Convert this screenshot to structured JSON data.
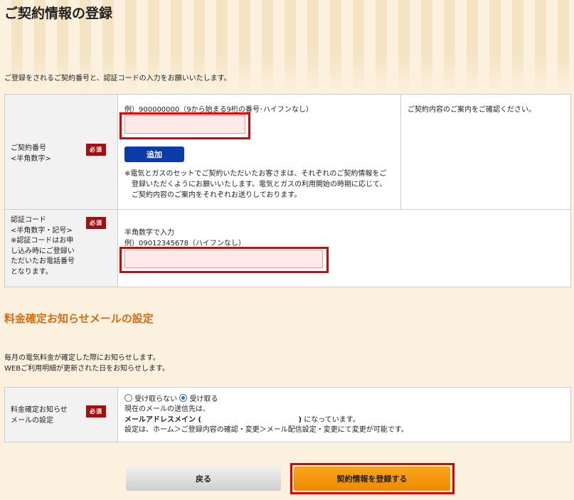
{
  "page": {
    "title": "ご契約情報の登録",
    "intro": "ご登録をされるご契約番号と、認証コードの入力をお願いいたします。"
  },
  "contract": {
    "label_line1": "ご契約番号",
    "label_line2": "<半角数字>",
    "required": "必須",
    "example": "例）900000000（9から始まる9桁の番号･ハイフンなし）",
    "value": "",
    "add_button": "追加",
    "note_line1": "※電気とガスのセットでご契約いただいたお客さまは、それぞれのご契約情報をご",
    "note_line2": "登録いただくようにお願いいたします。電気とガスの利用開始の時期に応じて、",
    "note_line3": "ご契約内容のご案内をそれぞれお送りしております。",
    "side_note": "ご契約内容のご案内をご確認ください。"
  },
  "auth": {
    "label_lines": [
      "認証コード",
      "<半角数字・記号>",
      "※認証コードはお申",
      "し込み時にご登録い",
      "ただいたお電話番号",
      "となります。"
    ],
    "required": "必須",
    "hint": "半角数字で入力",
    "example": "例）09012345678（ハイフンなし）",
    "value": ""
  },
  "mail_section": {
    "title": "料金確定お知らせメールの設定",
    "desc_line1": "毎月の電気料金が確定した際にお知らせします。",
    "desc_line2": "WEBご利用明細が更新された日をお知らせします。"
  },
  "mail": {
    "label_line1": "料金確定お知らせ",
    "label_line2": "メールの設定",
    "required": "必須",
    "option_no": "受け取らない",
    "option_yes": "受け取る",
    "selected": "受け取る",
    "current_prefix": "現在のメールの送信先は、",
    "address_label": "メールアドレスメイン (",
    "address_close": ")",
    "address_suffix": " になっています。",
    "settings_note": "設定は、ホーム＞ご登録内容の確認・変更＞メール配信設定・変更にて変更が可能です。"
  },
  "buttons": {
    "back": "戻る",
    "submit": "契約情報を登録する"
  },
  "colors": {
    "required_badge": "#a40f12",
    "add_button": "#0a3ca8",
    "highlight": "#e00000",
    "section_title": "#d96b0f",
    "submit_button": "#ef8a00"
  }
}
